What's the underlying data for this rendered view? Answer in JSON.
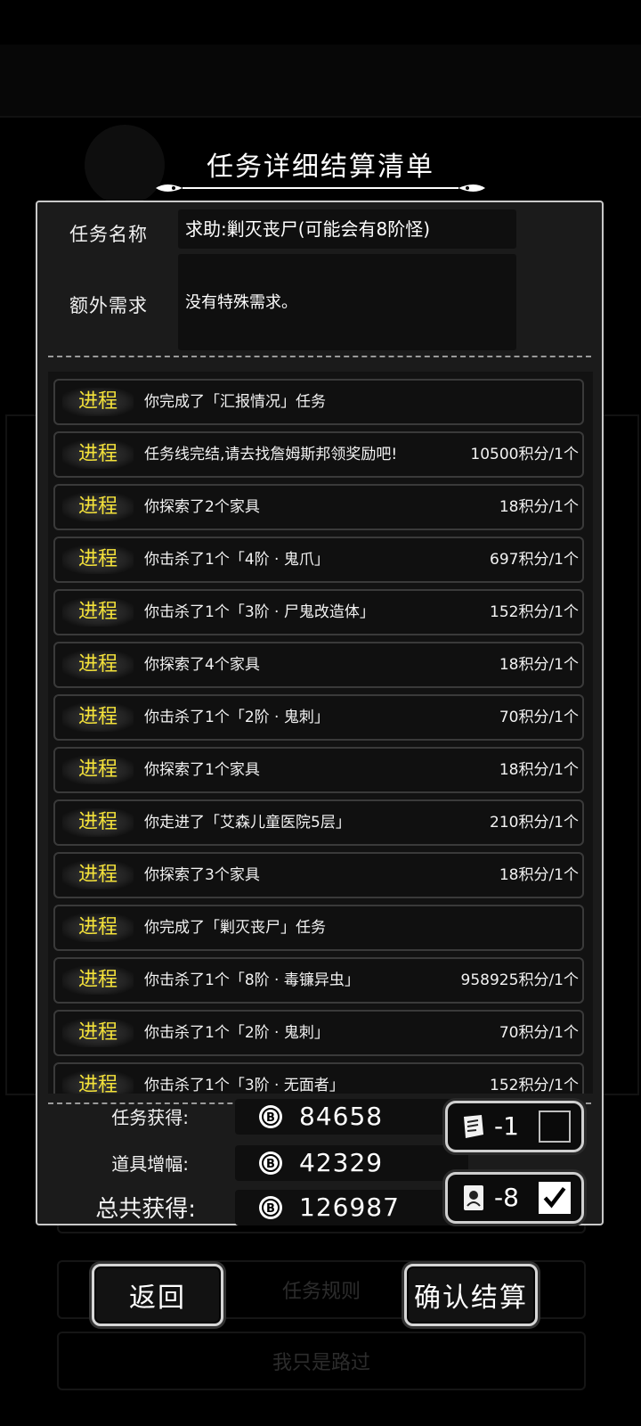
{
  "title": "任务详细结算清单",
  "task": {
    "name_label": "任务名称",
    "name_value": "求助:剿灭丧尸(可能会有8阶怪)",
    "extra_label": "额外需求",
    "extra_value": "没有特殊需求。"
  },
  "rows": [
    {
      "tag": "进程",
      "text": "你完成了「汇报情况」任务",
      "reward": ""
    },
    {
      "tag": "进程",
      "text": "任务线完结,请去找詹姆斯邦领奖励吧!",
      "reward": "10500积分/1个"
    },
    {
      "tag": "进程",
      "text": "你探索了2个家具",
      "reward": "18积分/1个"
    },
    {
      "tag": "进程",
      "text": "你击杀了1个「4阶 · 鬼爪」",
      "reward": "697积分/1个"
    },
    {
      "tag": "进程",
      "text": "你击杀了1个「3阶 · 尸鬼改造体」",
      "reward": "152积分/1个"
    },
    {
      "tag": "进程",
      "text": "你探索了4个家具",
      "reward": "18积分/1个"
    },
    {
      "tag": "进程",
      "text": "你击杀了1个「2阶 · 鬼刺」",
      "reward": "70积分/1个"
    },
    {
      "tag": "进程",
      "text": "你探索了1个家具",
      "reward": "18积分/1个"
    },
    {
      "tag": "进程",
      "text": "你走进了「艾森儿童医院5层」",
      "reward": "210积分/1个"
    },
    {
      "tag": "进程",
      "text": "你探索了3个家具",
      "reward": "18积分/1个"
    },
    {
      "tag": "进程",
      "text": "你完成了「剿灭丧尸」任务",
      "reward": ""
    },
    {
      "tag": "进程",
      "text": "你击杀了1个「8阶 · 毒镰异虫」",
      "reward": "958925积分/1个"
    },
    {
      "tag": "进程",
      "text": "你击杀了1个「2阶 · 鬼刺」",
      "reward": "70积分/1个"
    },
    {
      "tag": "进程",
      "text": "你击杀了1个「3阶 · 无面者」",
      "reward": "152积分/1个"
    }
  ],
  "summary": {
    "task_label": "任务获得:",
    "task_value": "84658",
    "item_label": "道具增幅:",
    "item_value": "42329",
    "total_label": "总共获得:",
    "total_value": "126987"
  },
  "items": [
    {
      "icon": "scroll-icon",
      "count": "-1",
      "checked": false
    },
    {
      "icon": "card-icon",
      "count": "-8",
      "checked": true
    }
  ],
  "buttons": {
    "back": "返回",
    "rules": "任务规则",
    "confirm": "确认结算",
    "pass": "我只是路过"
  },
  "colors": {
    "tag": "#f4e23a",
    "border": "#c9c9c9",
    "panel": "#1b1b1b"
  }
}
